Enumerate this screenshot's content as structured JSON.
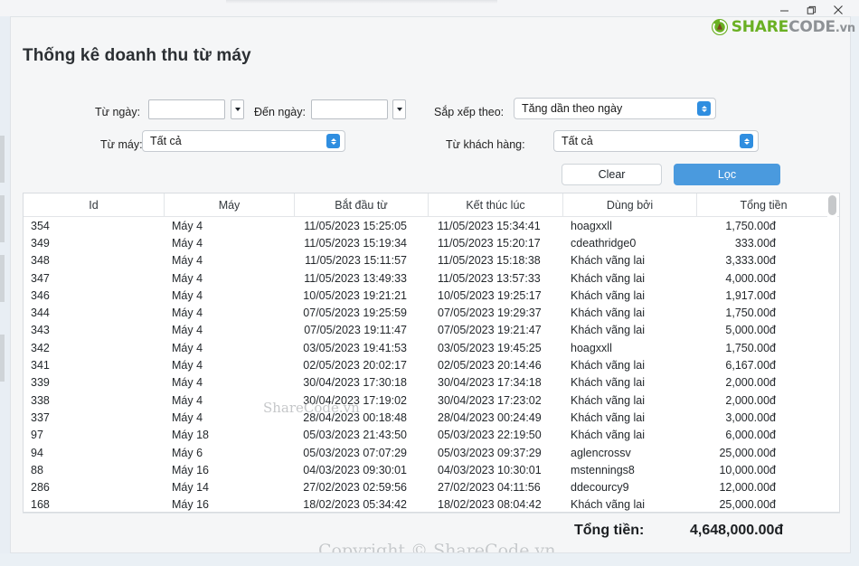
{
  "window": {
    "controls": [
      {
        "name": "minimize",
        "glyph": "minimize-icon"
      },
      {
        "name": "maximize",
        "glyph": "restore-icon"
      },
      {
        "name": "close",
        "glyph": "close-icon"
      }
    ]
  },
  "logo": {
    "mark": "sharecode-leaf-icon",
    "part1": "SHARE",
    "part2": "CODE",
    "part3": ".vn",
    "color_green": "#6ab023",
    "color_gray": "#8e9296"
  },
  "page": {
    "title": "Thống kê doanh thu từ máy"
  },
  "filters": {
    "from_date_label": "Từ ngày:",
    "from_date_value": "",
    "from_date_placeholder": "",
    "to_date_label": "Đến ngày:",
    "to_date_value": "",
    "to_date_placeholder": "",
    "sort_label": "Sắp xếp theo:",
    "sort_value": "Tăng dần theo ngày",
    "machine_label": "Từ máy:",
    "machine_value": "Tất cả",
    "customer_label": "Từ khách hàng:",
    "customer_value": "Tất cả",
    "clear_label": "Clear",
    "filter_label": "Lọc",
    "accent_color": "#4a9ade",
    "combo_btn_color": "#2f8ee0"
  },
  "table": {
    "columns": [
      "Id",
      "Máy",
      "Bắt đầu từ",
      "Kết thúc lúc",
      "Dùng bởi",
      "Tổng tiền"
    ],
    "rows": [
      [
        "354",
        "Máy 4",
        "11/05/2023 15:25:05",
        "11/05/2023 15:34:41",
        "hoagxxll",
        "1,750.00đ"
      ],
      [
        "349",
        "Máy 4",
        "11/05/2023 15:19:34",
        "11/05/2023 15:20:17",
        "cdeathridge0",
        "333.00đ"
      ],
      [
        "348",
        "Máy 4",
        "11/05/2023 15:11:57",
        "11/05/2023 15:18:38",
        "Khách vãng lai",
        "3,333.00đ"
      ],
      [
        "347",
        "Máy 4",
        "11/05/2023 13:49:33",
        "11/05/2023 13:57:33",
        "Khách vãng lai",
        "4,000.00đ"
      ],
      [
        "346",
        "Máy 4",
        "10/05/2023 19:21:21",
        "10/05/2023 19:25:17",
        "Khách vãng lai",
        "1,917.00đ"
      ],
      [
        "344",
        "Máy 4",
        "07/05/2023 19:25:59",
        "07/05/2023 19:29:37",
        "Khách vãng lai",
        "1,750.00đ"
      ],
      [
        "343",
        "Máy 4",
        "07/05/2023 19:11:47",
        "07/05/2023 19:21:47",
        "Khách vãng lai",
        "5,000.00đ"
      ],
      [
        "342",
        "Máy 4",
        "03/05/2023 19:41:53",
        "03/05/2023 19:45:25",
        "hoagxxll",
        "1,750.00đ"
      ],
      [
        "341",
        "Máy 4",
        "02/05/2023 20:02:17",
        "02/05/2023 20:14:46",
        "Khách vãng lai",
        "6,167.00đ"
      ],
      [
        "339",
        "Máy 4",
        "30/04/2023 17:30:18",
        "30/04/2023 17:34:18",
        "Khách vãng lai",
        "2,000.00đ"
      ],
      [
        "338",
        "Máy 4",
        "30/04/2023 17:19:02",
        "30/04/2023 17:23:02",
        "Khách vãng lai",
        "2,000.00đ"
      ],
      [
        "337",
        "Máy 4",
        "28/04/2023 00:18:48",
        "28/04/2023 00:24:49",
        "Khách vãng lai",
        "3,000.00đ"
      ],
      [
        "97",
        "Máy 18",
        "05/03/2023 21:43:50",
        "05/03/2023 22:19:50",
        "Khách vãng lai",
        "6,000.00đ"
      ],
      [
        "94",
        "Máy 6",
        "05/03/2023 07:07:29",
        "05/03/2023 09:37:29",
        "aglencrossv",
        "25,000.00đ"
      ],
      [
        "88",
        "Máy 16",
        "04/03/2023 09:30:01",
        "04/03/2023 10:30:01",
        "mstennings8",
        "10,000.00đ"
      ],
      [
        "286",
        "Máy 14",
        "27/02/2023 02:59:56",
        "27/02/2023 04:11:56",
        "ddecourcy9",
        "12,000.00đ"
      ],
      [
        "168",
        "Máy 16",
        "18/02/2023 05:34:42",
        "18/02/2023 08:04:42",
        "Khách vãng lai",
        "25,000.00đ"
      ]
    ]
  },
  "footer": {
    "total_label": "Tổng tiền:",
    "total_value": "4,648,000.00đ"
  },
  "watermarks": {
    "table": "ShareCode.vn",
    "footer": "Copyright © ShareCode.vn"
  }
}
